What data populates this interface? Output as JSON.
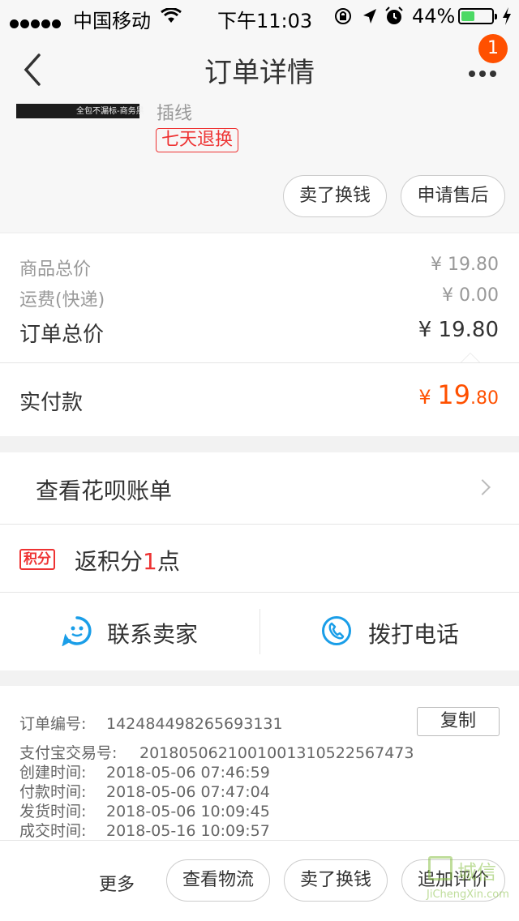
{
  "status_bar": {
    "carrier": "中国移动",
    "time": "下午11:03",
    "battery_percent": "44%",
    "battery_level": 0.44
  },
  "nav": {
    "title": "订单详情",
    "badge_count": "1"
  },
  "goods": {
    "thumb_caption": "全包不漏标-商务黑",
    "subtitle": "插线",
    "return_tag": "七天退换",
    "buttons": [
      "卖了换钱",
      "申请售后"
    ]
  },
  "prices": {
    "goods_total_label": "商品总价",
    "goods_total_value": "¥ 19.80",
    "shipping_label": "运费(快递)",
    "shipping_value": "¥ 0.00",
    "order_total_label": "订单总价",
    "order_total_value": "¥ 19.80"
  },
  "paid": {
    "label": "实付款",
    "currency": "¥ ",
    "integer": "19",
    "decimal": ".80"
  },
  "huabei": {
    "label": "查看花呗账单"
  },
  "points": {
    "tag": "积分",
    "text_before": "返积分",
    "number": "1",
    "text_after": "点"
  },
  "contact": {
    "seller_label": "联系卖家",
    "call_label": "拨打电话"
  },
  "order_info": {
    "copy_label": "复制",
    "lines": [
      {
        "key": "订单编号:",
        "value": "142484498265693131"
      },
      {
        "key": "支付宝交易号:",
        "value": "2018050621001001310522567473"
      },
      {
        "key": "创建时间:",
        "value": "2018-05-06 07:46:59"
      },
      {
        "key": "付款时间:",
        "value": "2018-05-06 07:47:04"
      },
      {
        "key": "发货时间:",
        "value": "2018-05-06 10:09:45"
      },
      {
        "key": "成交时间:",
        "value": "2018-05-16 10:09:57"
      }
    ]
  },
  "bottom_bar": {
    "more_label": "更多",
    "buttons": [
      "查看物流",
      "卖了换钱",
      "追加评价"
    ]
  },
  "watermark": {
    "cn": "城信",
    "en": "JiChengXin.com"
  },
  "colors": {
    "accent_orange": "#ff5000",
    "tag_red": "#e33333",
    "icon_blue": "#1a9ee8"
  }
}
